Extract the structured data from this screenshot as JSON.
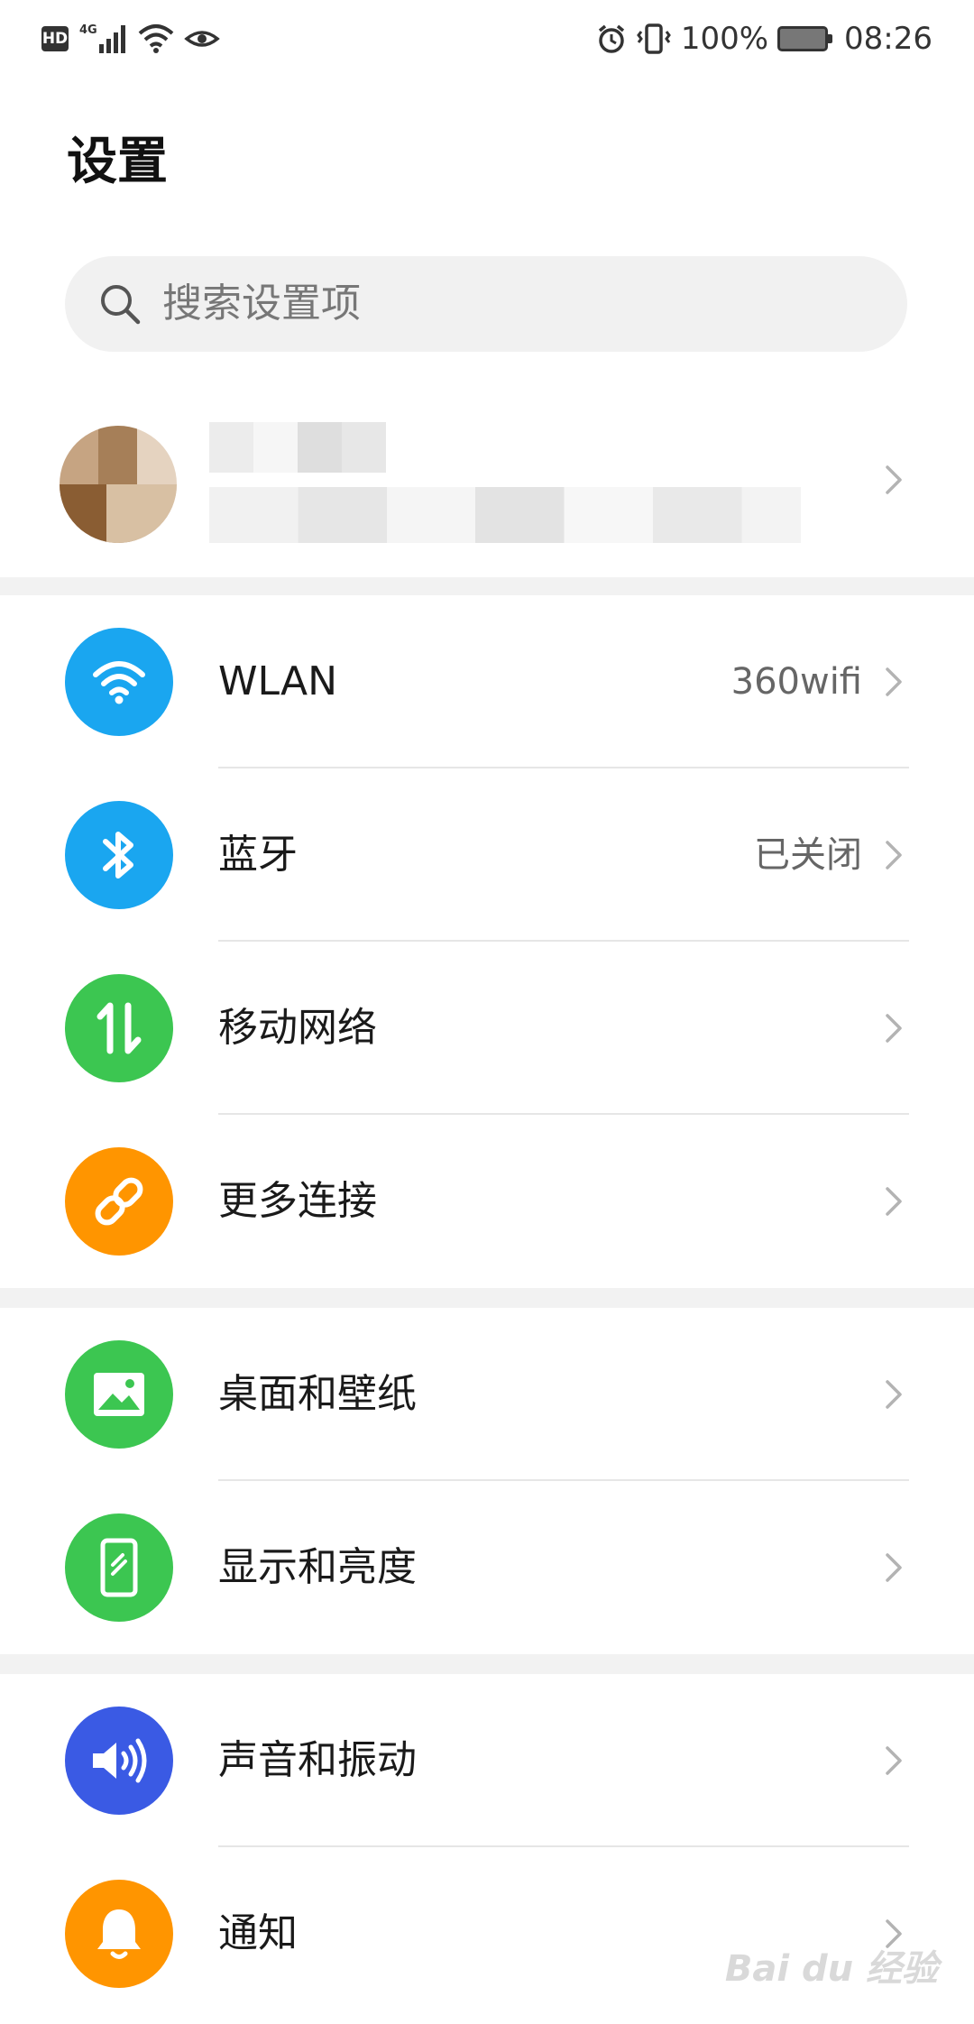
{
  "status_bar": {
    "hd_badge": "HD",
    "network_label": "4G",
    "battery_percent": "100%",
    "time": "08:26",
    "icons": [
      "signal-icon",
      "wifi-icon",
      "eye-icon",
      "alarm-icon",
      "vibrate-icon",
      "battery-icon"
    ]
  },
  "page": {
    "title": "设置"
  },
  "search": {
    "placeholder": "搜索设置项"
  },
  "groups": [
    {
      "items": [
        {
          "label": "WLAN",
          "value": "360wifi",
          "icon": "wifi-icon",
          "color": "#1aa6f0"
        },
        {
          "label": "蓝牙",
          "value": "已关闭",
          "icon": "bluetooth-icon",
          "color": "#1aa6f0"
        },
        {
          "label": "移动网络",
          "value": "",
          "icon": "mobile-data-icon",
          "color": "#3cc651"
        },
        {
          "label": "更多连接",
          "value": "",
          "icon": "link-icon",
          "color": "#ff9500"
        }
      ]
    },
    {
      "items": [
        {
          "label": "桌面和壁纸",
          "value": "",
          "icon": "wallpaper-icon",
          "color": "#3cc651"
        },
        {
          "label": "显示和亮度",
          "value": "",
          "icon": "display-icon",
          "color": "#3cc651"
        }
      ]
    },
    {
      "items": [
        {
          "label": "声音和振动",
          "value": "",
          "icon": "speaker-icon",
          "color": "#3a5ae4"
        },
        {
          "label": "通知",
          "value": "",
          "icon": "bell-icon",
          "color": "#ff9500"
        }
      ]
    }
  ],
  "watermark": "Bai du 经验"
}
